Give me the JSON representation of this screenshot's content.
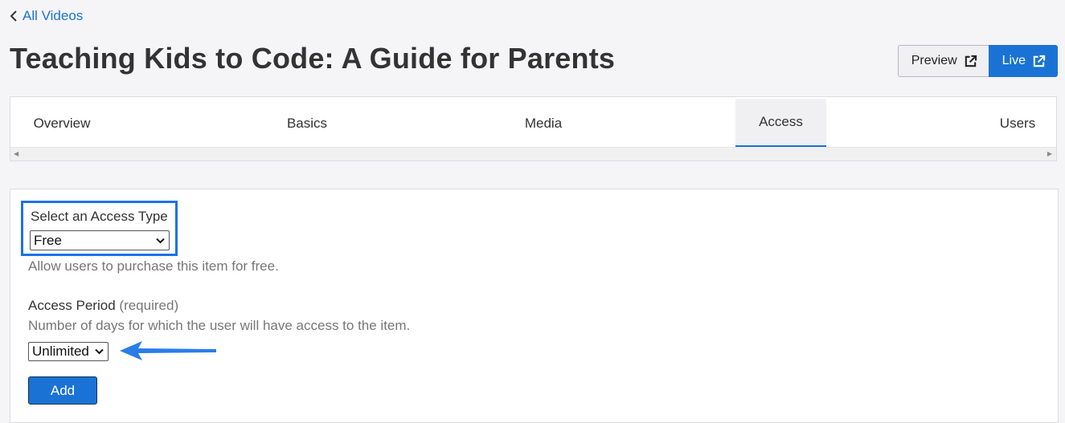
{
  "nav": {
    "back_label": "All Videos"
  },
  "page": {
    "title": "Teaching Kids to Code: A Guide for Parents"
  },
  "header_buttons": {
    "preview_label": "Preview",
    "live_label": "Live"
  },
  "tabs": [
    {
      "label": "Overview",
      "active": false
    },
    {
      "label": "Basics",
      "active": false
    },
    {
      "label": "Media",
      "active": false
    },
    {
      "label": "Access",
      "active": true
    },
    {
      "label": "Users",
      "active": false
    }
  ],
  "access_form": {
    "access_type_label": "Select an Access Type",
    "access_type_value": "Free",
    "access_type_help": "Allow users to purchase this item for free.",
    "period_label": "Access Period",
    "period_required": "(required)",
    "period_help": "Number of days for which the user will have access to the item.",
    "period_value": "Unlimited",
    "add_label": "Add"
  },
  "colors": {
    "accent": "#1a73d4",
    "highlight_border": "#1a73e8",
    "background": "#f5f5f8"
  },
  "icons": {
    "back": "chevron-left-icon",
    "external": "external-link-icon",
    "select": "chevron-down-icon",
    "annotation": "arrow-left-icon"
  }
}
